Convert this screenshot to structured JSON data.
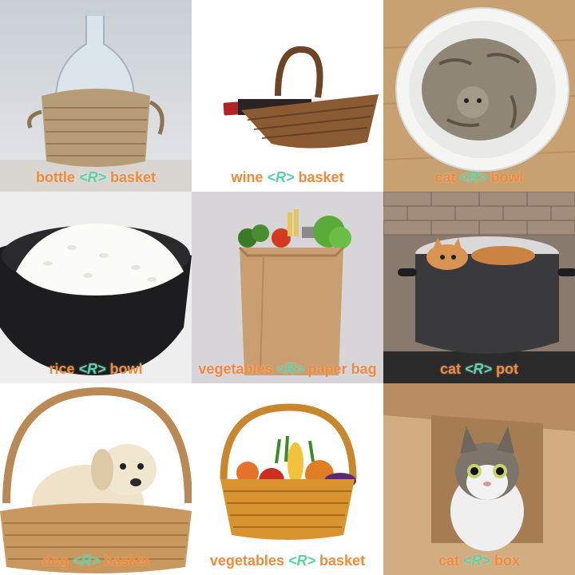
{
  "relation_token": "<R>",
  "colors": {
    "caption_text": "#f08a3c",
    "relation_token": "#5bd1a8"
  },
  "tiles": [
    {
      "subject": "bottle",
      "object": "basket"
    },
    {
      "subject": "wine",
      "object": "basket"
    },
    {
      "subject": "cat",
      "object": "bowl"
    },
    {
      "subject": "rice",
      "object": "bowl"
    },
    {
      "subject": "vegetables",
      "object": "paper bag"
    },
    {
      "subject": "cat",
      "object": "pot"
    },
    {
      "subject": "dog",
      "object": "basket"
    },
    {
      "subject": "vegetables",
      "object": "basket"
    },
    {
      "subject": "cat",
      "object": "box"
    }
  ]
}
